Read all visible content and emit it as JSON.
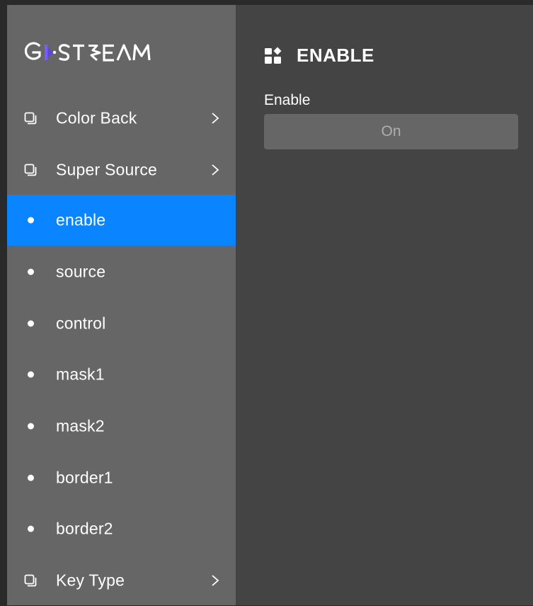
{
  "brand": {
    "logo_text": "GSTREAM",
    "accent_color": "#7b5cff"
  },
  "colors": {
    "sidebar_bg": "#666666",
    "main_bg": "#444444",
    "active_bg": "#0a84ff",
    "button_bg": "#666666"
  },
  "sidebar": {
    "items": [
      {
        "label": "Color Back",
        "icon": "folder-icon",
        "chevron": true
      },
      {
        "label": "Super Source",
        "icon": "folder-icon",
        "chevron": true
      },
      {
        "label": "enable",
        "icon": "dot-icon",
        "active": true
      },
      {
        "label": "source",
        "icon": "dot-icon"
      },
      {
        "label": "control",
        "icon": "dot-icon"
      },
      {
        "label": "mask1",
        "icon": "dot-icon"
      },
      {
        "label": "mask2",
        "icon": "dot-icon"
      },
      {
        "label": "border1",
        "icon": "dot-icon"
      },
      {
        "label": "border2",
        "icon": "dot-icon"
      },
      {
        "label": "Key Type",
        "icon": "folder-icon",
        "chevron": true
      }
    ]
  },
  "main": {
    "header_icon": "widgets-icon",
    "title": "ENABLE",
    "field": {
      "label": "Enable",
      "value": "On"
    }
  }
}
